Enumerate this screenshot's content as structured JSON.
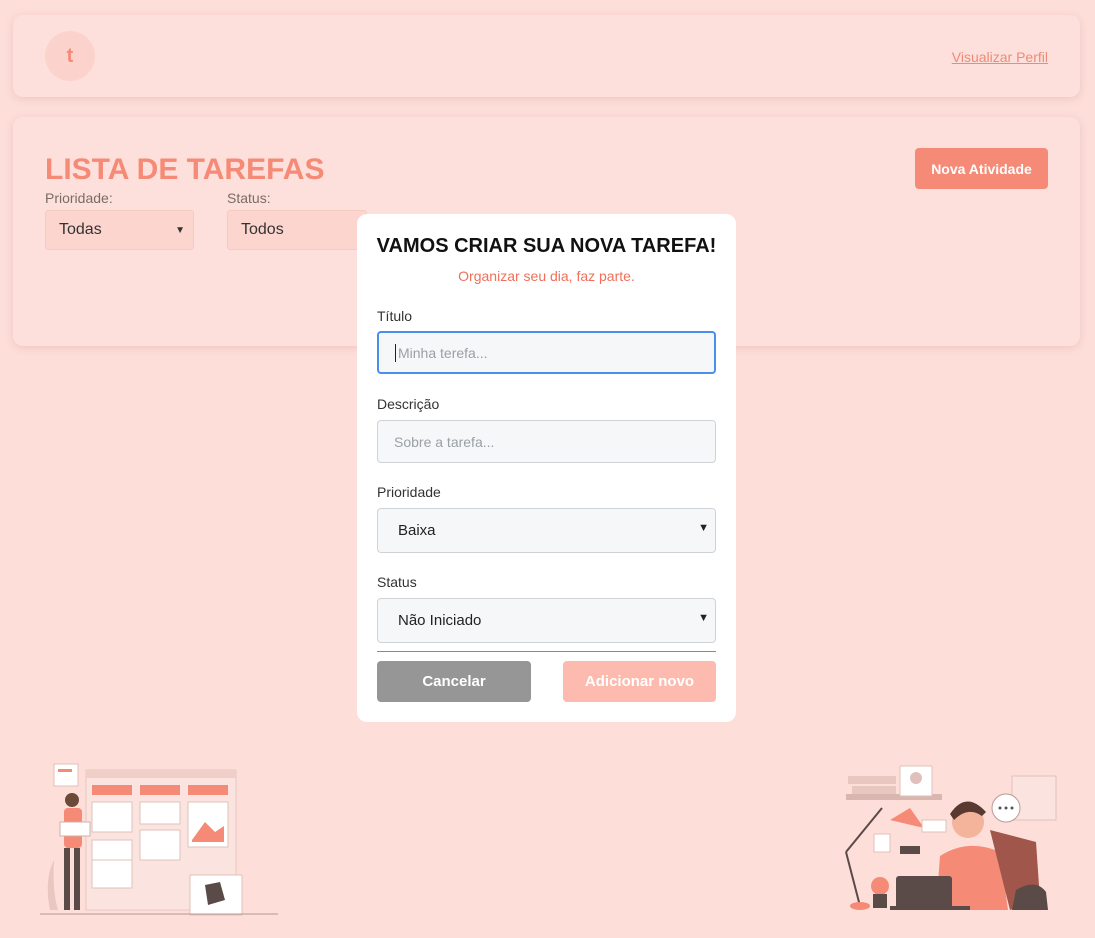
{
  "header": {
    "avatar_letter": "t",
    "profile_link": "Visualizar Perfil"
  },
  "panel": {
    "title": "LISTA DE TAREFAS",
    "new_button": "Nova Atividade",
    "filters": [
      {
        "label": "Prioridade:",
        "value": "Todas"
      },
      {
        "label": "Status:",
        "value": "Todos"
      }
    ]
  },
  "modal": {
    "title": "VAMOS CRIAR SUA NOVA TAREFA!",
    "subtitle": "Organizar seu dia, faz parte.",
    "fields": {
      "title": {
        "label": "Título",
        "placeholder": "Minha terefa..."
      },
      "description": {
        "label": "Descrição",
        "placeholder": "Sobre a tarefa..."
      },
      "priority": {
        "label": "Prioridade",
        "value": "Baixa"
      },
      "status": {
        "label": "Status",
        "value": "Não Iniciado"
      }
    },
    "cancel_button": "Cancelar",
    "add_button": "Adicionar novo"
  },
  "colors": {
    "accent": "#f58a76",
    "background": "#fdded9",
    "focus": "#4c8df0"
  }
}
